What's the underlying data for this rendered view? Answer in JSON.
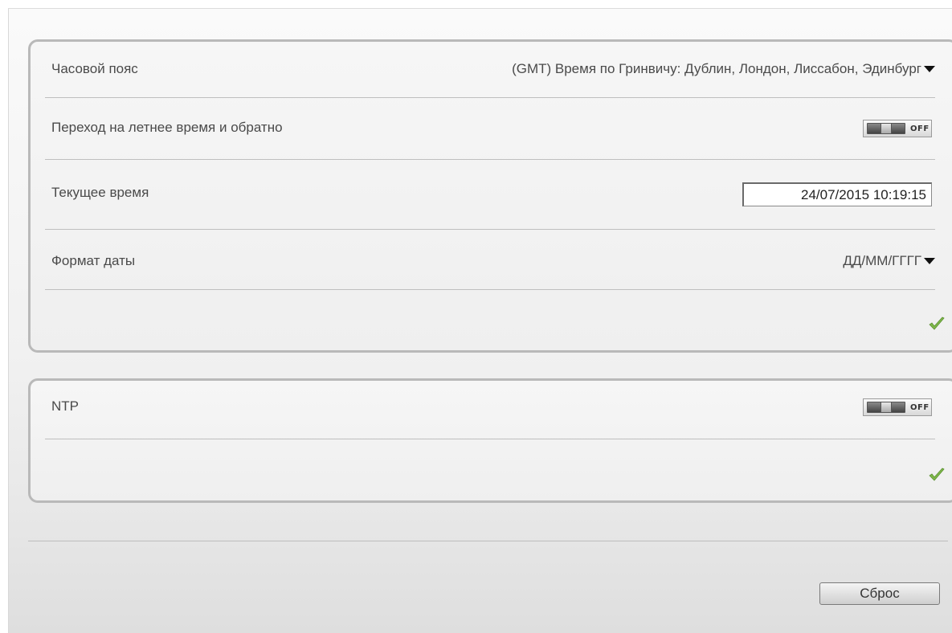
{
  "settings": {
    "timezone": {
      "label": "Часовой пояс",
      "value": "(GMT) Время по Гринвичу: Дублин, Лондон, Лиссабон, Эдинбург"
    },
    "dst": {
      "label": "Переход на летнее время и обратно",
      "toggle_state": "OFF"
    },
    "current_time": {
      "label": "Текущее время",
      "value": "24/07/2015 10:19:15"
    },
    "date_format": {
      "label": "Формат даты",
      "value": "ДД/ММ/ГГГГ"
    },
    "apply_icon": "checkmark-icon"
  },
  "ntp": {
    "label": "NTP",
    "toggle_state": "OFF",
    "apply_icon": "checkmark-icon"
  },
  "footer": {
    "reset_label": "Сброс"
  },
  "colors": {
    "checkmark": "#7fb84a",
    "panel_border": "#b9b9b9",
    "text": "#4a4a4a"
  }
}
